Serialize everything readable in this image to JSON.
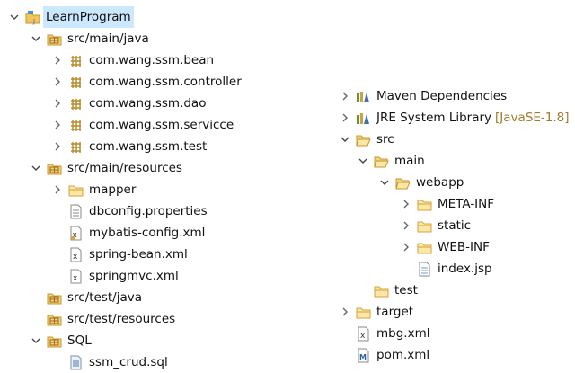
{
  "left_tree": {
    "project": "LearnProgram",
    "src_main_java": "src/main/java",
    "pkg_bean": "com.wang.ssm.bean",
    "pkg_controller": "com.wang.ssm.controller",
    "pkg_dao": "com.wang.ssm.dao",
    "pkg_servicce": "com.wang.ssm.servicce",
    "pkg_test": "com.wang.ssm.test",
    "src_main_resources": "src/main/resources",
    "mapper": "mapper",
    "dbconfig": "dbconfig.properties",
    "mybatis_config": "mybatis-config.xml",
    "spring_bean": "spring-bean.xml",
    "springmvc": "springmvc.xml",
    "src_test_java": "src/test/java",
    "src_test_resources": "src/test/resources",
    "sql": "SQL",
    "ssm_crud": "ssm_crud.sql"
  },
  "right_tree": {
    "maven_deps": "Maven Dependencies",
    "jre_lib": "JRE System Library",
    "jre_version": "[JavaSE-1.8]",
    "src": "src",
    "main": "main",
    "webapp": "webapp",
    "meta_inf": "META-INF",
    "static": "static",
    "web_inf": "WEB-INF",
    "index_jsp": "index.jsp",
    "test": "test",
    "target": "target",
    "mbg_xml": "mbg.xml",
    "pom_xml": "pom.xml"
  },
  "colors": {
    "folder": "#e6b84a",
    "package": "#b58a2a",
    "selection": "#cce8ff",
    "decoration": "#a07a2a"
  }
}
